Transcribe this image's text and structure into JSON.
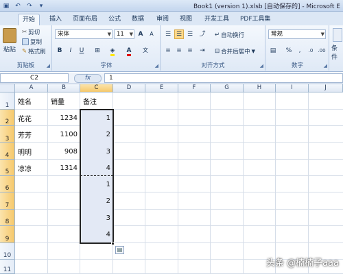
{
  "titlebar": {
    "title": "Book1 (version 1).xlsb [自动保存的] - Microsoft E",
    "qat": [
      "save-icon",
      "undo-icon",
      "redo-icon",
      "customize-icon"
    ]
  },
  "tabs": [
    "开始",
    "插入",
    "页面布局",
    "公式",
    "数据",
    "审阅",
    "视图",
    "开发工具",
    "PDF工具集"
  ],
  "ribbon": {
    "clipboard": {
      "paste": "粘贴",
      "cut": "剪切",
      "copy": "复制",
      "format_painter": "格式刷",
      "label": "剪贴板"
    },
    "font": {
      "name": "宋体",
      "size": "11",
      "grow": "A",
      "shrink": "A",
      "bold": "B",
      "italic": "I",
      "underline": "U",
      "label": "字体"
    },
    "alignment": {
      "wrap": "自动换行",
      "merge": "合并后居中",
      "label": "对齐方式"
    },
    "number": {
      "format": "常规",
      "percent": "%",
      "comma": ",",
      "label": "数字"
    },
    "styles": {
      "cond": "条件"
    }
  },
  "formula_bar": {
    "name_box": "C2",
    "fx": "fx",
    "content": "1"
  },
  "sheet": {
    "columns": [
      "A",
      "B",
      "C",
      "D",
      "E",
      "F",
      "G",
      "H",
      "I",
      "J"
    ],
    "rows": [
      "1",
      "2",
      "3",
      "4",
      "5",
      "6",
      "7",
      "8",
      "9",
      "10",
      "11"
    ],
    "headers": [
      "姓名",
      "销量",
      "备注"
    ],
    "data": [
      {
        "name": "花花",
        "sales": "1234",
        "note": "1"
      },
      {
        "name": "芳芳",
        "sales": "1100",
        "note": "2"
      },
      {
        "name": "明明",
        "sales": "908",
        "note": "3"
      },
      {
        "name": "凉凉",
        "sales": "1314",
        "note": "4"
      }
    ],
    "pasted": [
      "1",
      "2",
      "3",
      "4"
    ]
  },
  "watermark": "头条 @楠楠子aaa"
}
